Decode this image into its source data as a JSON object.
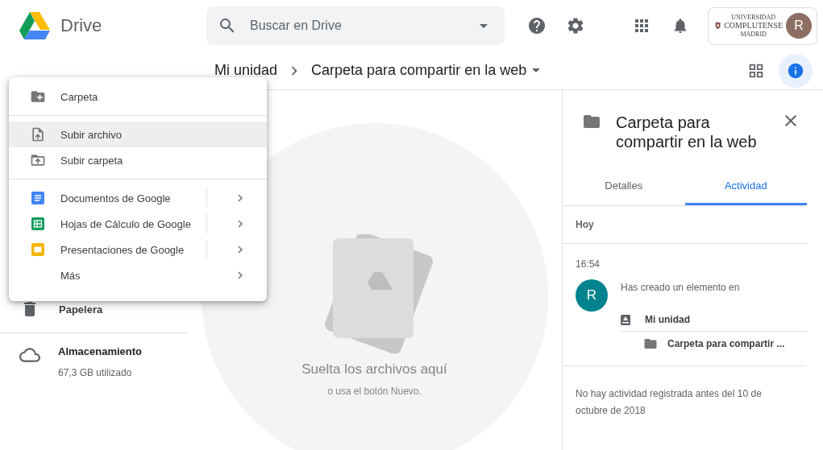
{
  "header": {
    "product": "Drive",
    "search": {
      "placeholder": "Buscar en Drive"
    },
    "account": {
      "org_lines": [
        "UNIVERSIDAD",
        "COMPLUTENSE",
        "MADRID"
      ],
      "avatar": "R"
    }
  },
  "breadcrumb": {
    "items": [
      "Mi unidad",
      "Carpeta para compartir en la web"
    ]
  },
  "new_menu": {
    "sections": [
      {
        "items": [
          {
            "label": "Carpeta",
            "kind": "new-folder",
            "highlighted": false,
            "submenu": false,
            "split": false
          }
        ]
      },
      {
        "items": [
          {
            "label": "Subir archivo",
            "kind": "upload-file",
            "highlighted": true,
            "submenu": false,
            "split": false
          },
          {
            "label": "Subir carpeta",
            "kind": "upload-folder",
            "highlighted": false,
            "submenu": false,
            "split": false
          }
        ]
      },
      {
        "items": [
          {
            "label": "Documentos de Google",
            "kind": "docs",
            "highlighted": false,
            "submenu": true,
            "split": true
          },
          {
            "label": "Hojas de Cálculo de Google",
            "kind": "sheets",
            "highlighted": false,
            "submenu": true,
            "split": true
          },
          {
            "label": "Presentaciones de Google",
            "kind": "slides",
            "highlighted": false,
            "submenu": true,
            "split": true
          },
          {
            "label": "Más",
            "kind": "none",
            "highlighted": false,
            "submenu": true,
            "split": false
          }
        ]
      }
    ]
  },
  "sidebar": {
    "items": [
      {
        "label": "Papelera"
      }
    ],
    "storage": {
      "label": "Almacenamiento",
      "usage": "67,3 GB utilizado"
    }
  },
  "drop_zone": {
    "title": "Suelta los archivos aquí",
    "hint": "o usa el botón Nuevo."
  },
  "details": {
    "title": "Carpeta para compartir en la web",
    "tabs": [
      {
        "label": "Detalles",
        "selected": false
      },
      {
        "label": "Actividad",
        "selected": true
      }
    ],
    "activity": {
      "day": "Hoy",
      "time": "16:54",
      "avatar": "R",
      "message": "Has creado un elemento en",
      "drive": "Mi unidad",
      "folder": "Carpeta para compartir ..."
    },
    "note": "No hay actividad registrada antes del 10 de octubre de 2018"
  }
}
